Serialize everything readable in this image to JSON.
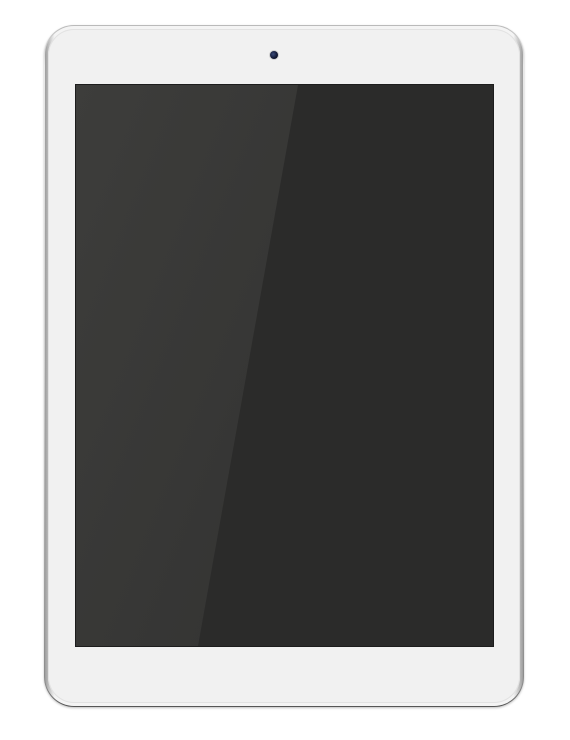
{
  "device": {
    "kind": "tablet",
    "orientation": "portrait",
    "body_color": "#f1f1f1",
    "rim_color": "#bdbdbd",
    "screen_color": "#2b2b2a",
    "screen_glare_color": "#3a3a38",
    "screen_state": "off"
  },
  "icons": {
    "camera": "front-camera-icon"
  }
}
